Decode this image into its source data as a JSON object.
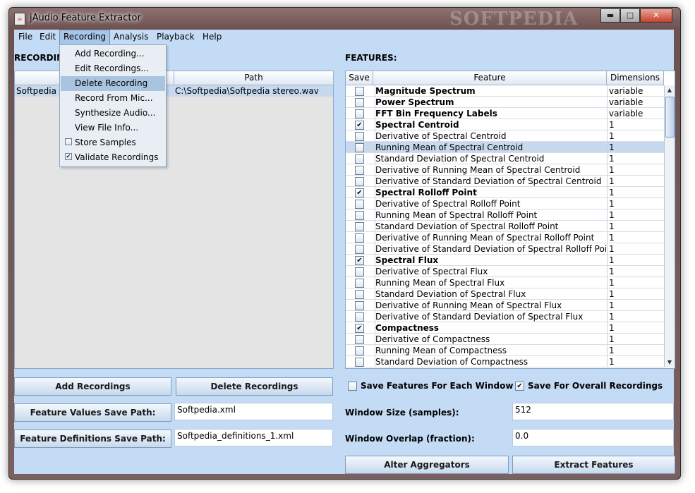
{
  "window": {
    "title": "jAudio Feature Extractor",
    "watermark": "SOFTPEDIA",
    "min_glyph": "▬",
    "max_glyph": "□",
    "close_glyph": "✕"
  },
  "menubar": [
    "File",
    "Edit",
    "Recording",
    "Analysis",
    "Playback",
    "Help"
  ],
  "recording_menu": [
    {
      "label": "Add Recording..."
    },
    {
      "label": "Edit Recordings..."
    },
    {
      "label": "Delete Recording",
      "highlighted": true
    },
    {
      "label": "Record From Mic..."
    },
    {
      "label": "Synthesize Audio..."
    },
    {
      "label": "View File Info..."
    },
    {
      "label": "Store Samples",
      "checkbox": true,
      "checked": false
    },
    {
      "label": "Validate Recordings",
      "checkbox": true,
      "checked": true
    }
  ],
  "recordings": {
    "label": "RECORDING",
    "path_header": "Path",
    "rows": [
      {
        "name": "Softpedia s",
        "path": "C:\\Softpedia\\Softpedia stereo.wav"
      }
    ]
  },
  "features": {
    "label": "FEATURES:",
    "headers": {
      "save": "Save",
      "feature": "Feature",
      "dimensions": "Dimensions"
    },
    "rows": [
      {
        "name": "Magnitude Spectrum",
        "dim": "variable",
        "checked": false,
        "bold": true
      },
      {
        "name": "Power Spectrum",
        "dim": "variable",
        "checked": false,
        "bold": true
      },
      {
        "name": "FFT Bin Frequency Labels",
        "dim": "variable",
        "checked": false,
        "bold": true
      },
      {
        "name": "Spectral Centroid",
        "dim": "1",
        "checked": true,
        "bold": true
      },
      {
        "name": "Derivative of Spectral Centroid",
        "dim": "1",
        "checked": false,
        "bold": false
      },
      {
        "name": "Running Mean of Spectral Centroid",
        "dim": "1",
        "checked": false,
        "bold": false,
        "selected": true
      },
      {
        "name": "Standard Deviation of Spectral Centroid",
        "dim": "1",
        "checked": false,
        "bold": false
      },
      {
        "name": "Derivative of Running Mean of Spectral Centroid",
        "dim": "1",
        "checked": false,
        "bold": false
      },
      {
        "name": "Derivative of Standard Deviation of Spectral Centroid",
        "dim": "1",
        "checked": false,
        "bold": false
      },
      {
        "name": "Spectral Rolloff Point",
        "dim": "1",
        "checked": true,
        "bold": true
      },
      {
        "name": "Derivative of Spectral Rolloff Point",
        "dim": "1",
        "checked": false,
        "bold": false
      },
      {
        "name": "Running Mean of Spectral Rolloff Point",
        "dim": "1",
        "checked": false,
        "bold": false
      },
      {
        "name": "Standard Deviation of Spectral Rolloff Point",
        "dim": "1",
        "checked": false,
        "bold": false
      },
      {
        "name": "Derivative of Running Mean of Spectral Rolloff Point",
        "dim": "1",
        "checked": false,
        "bold": false
      },
      {
        "name": "Derivative of Standard Deviation of Spectral Rolloff Point",
        "dim": "1",
        "checked": false,
        "bold": false
      },
      {
        "name": "Spectral Flux",
        "dim": "1",
        "checked": true,
        "bold": true
      },
      {
        "name": "Derivative of Spectral Flux",
        "dim": "1",
        "checked": false,
        "bold": false
      },
      {
        "name": "Running Mean of Spectral Flux",
        "dim": "1",
        "checked": false,
        "bold": false
      },
      {
        "name": "Standard Deviation of Spectral Flux",
        "dim": "1",
        "checked": false,
        "bold": false
      },
      {
        "name": "Derivative of Running Mean of Spectral Flux",
        "dim": "1",
        "checked": false,
        "bold": false
      },
      {
        "name": "Derivative of Standard Deviation of Spectral Flux",
        "dim": "1",
        "checked": false,
        "bold": false
      },
      {
        "name": "Compactness",
        "dim": "1",
        "checked": true,
        "bold": true
      },
      {
        "name": "Derivative of Compactness",
        "dim": "1",
        "checked": false,
        "bold": false
      },
      {
        "name": "Running Mean of Compactness",
        "dim": "1",
        "checked": false,
        "bold": false
      },
      {
        "name": "Standard Deviation of Compactness",
        "dim": "1",
        "checked": false,
        "bold": false
      }
    ]
  },
  "buttons": {
    "add_recordings": "Add Recordings",
    "delete_recordings": "Delete Recordings",
    "feature_values_path": "Feature Values Save Path:",
    "feature_definitions_path": "Feature Definitions Save Path:",
    "alter_aggregators": "Alter Aggregators",
    "extract_features": "Extract Features"
  },
  "fields": {
    "feature_values_path": "Softpedia.xml",
    "feature_definitions_path": "Softpedia_definitions_1.xml",
    "window_size": "512",
    "window_overlap": "0.0"
  },
  "options": {
    "save_each_window": {
      "label": "Save Features For Each Window",
      "checked": false
    },
    "save_overall": {
      "label": "Save For Overall Recordings",
      "checked": true
    }
  },
  "labels": {
    "window_size": "Window Size (samples):",
    "window_overlap": "Window Overlap (fraction):"
  },
  "glyphs": {
    "check": "✔",
    "scroll_up": "▲",
    "scroll_down": "▼"
  }
}
